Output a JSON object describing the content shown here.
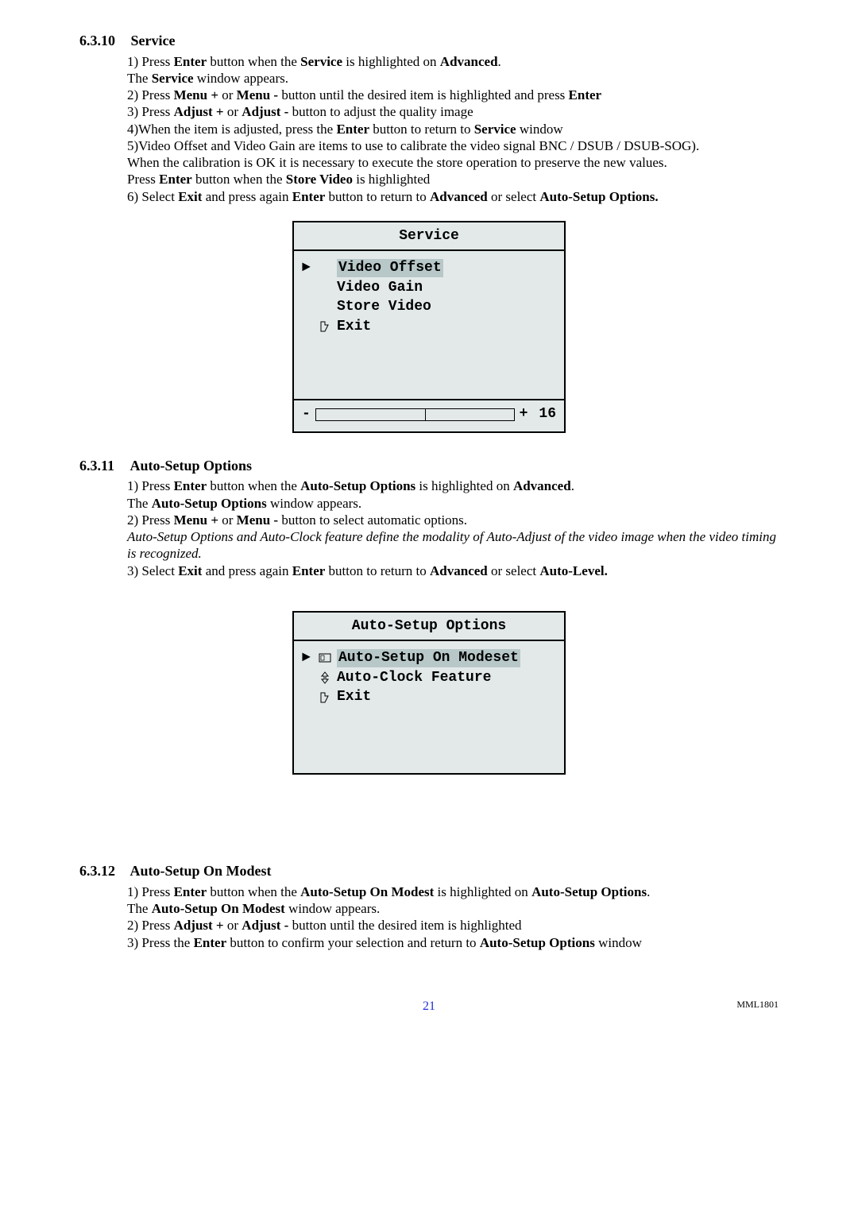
{
  "sections": {
    "service": {
      "num": "6.3.10",
      "title": "Service",
      "lines": {
        "l1a": "1) Press ",
        "l1b": "Enter",
        "l1c": " button when the ",
        "l1d": "Service",
        "l1e": " is highlighted on ",
        "l1f": "Advanced",
        "l1g": ".",
        "l2a": "The ",
        "l2b": "Service",
        "l2c": " window appears.",
        "l3a": "2) Press ",
        "l3b": "Menu +",
        "l3c": " or ",
        "l3d": "Menu -",
        "l3e": " button until the desired item is highlighted and press ",
        "l3f": "Enter",
        "l4a": "3) Press ",
        "l4b": "Adjust +",
        "l4c": " or ",
        "l4d": "Adjust -",
        "l4e": " button to adjust the quality image",
        "l5a": "4)When the item is adjusted, press the ",
        "l5b": "Enter",
        "l5c": " button to return to ",
        "l5d": "Service",
        "l5e": " window",
        "l6": "5)Video Offset and Video Gain  are items to use to calibrate the video signal BNC / DSUB / DSUB-SOG).",
        "l7": "When the calibration is OK it is necessary to execute the store operation to preserve the new values.",
        "l8a": "Press ",
        "l8b": "Enter",
        "l8c": " button when the ",
        "l8d": "Store Video",
        "l8e": " is highlighted",
        "l9a": "6) Select ",
        "l9b": "Exit",
        "l9c": " and press again ",
        "l9d": "Enter",
        "l9e": " button to return to ",
        "l9f": "Advanced",
        "l9g": " or select  ",
        "l9h": "Auto-Setup Options."
      },
      "osd": {
        "title": "Service",
        "item1": "Video Offset",
        "item2": "Video Gain",
        "item3": "Store Video",
        "item4": "Exit",
        "minus": "-",
        "plus": "+",
        "value": "16"
      }
    },
    "auto_options": {
      "num": "6.3.11",
      "title": "Auto-Setup Options",
      "lines": {
        "l1a": "1) Press ",
        "l1b": "Enter",
        "l1c": " button when the ",
        "l1d": "Auto-Setup Options",
        "l1e": " is highlighted on ",
        "l1f": "Advanced",
        "l1g": ".",
        "l2a": "The ",
        "l2b": "Auto-Setup Options",
        "l2c": " window appears.",
        "l3a": "2) Press ",
        "l3b": "Menu +",
        "l3c": " or ",
        "l3d": "Menu -",
        "l3e": " button to select automatic options.",
        "l4": "Auto-Setup Options and Auto-Clock feature define the modality of Auto-Adjust of the video image when the video timing is recognized.",
        "l5a": "3) Select ",
        "l5b": "Exit",
        "l5c": " and press again ",
        "l5d": "Enter",
        "l5e": " button to return to ",
        "l5f": "Advanced",
        "l5g": " or select  ",
        "l5h": "Auto-Level."
      },
      "osd": {
        "title": "Auto-Setup Options",
        "item1": "Auto-Setup On Modeset",
        "item2": "Auto-Clock Feature",
        "item3": "Exit"
      }
    },
    "auto_modest": {
      "num": "6.3.12",
      "title": "Auto-Setup On Modest",
      "lines": {
        "l1a": "1) Press ",
        "l1b": "Enter",
        "l1c": " button when the ",
        "l1d": "Auto-Setup On Modest",
        "l1e": " is highlighted on ",
        "l1f": "Auto-Setup Options",
        "l1g": ".",
        "l2a": "The ",
        "l2b": "Auto-Setup On Modest",
        "l2c": " window appears.",
        "l3a": "2) Press ",
        "l3b": "Adjust +",
        "l3c": " or ",
        "l3d": "Adjust -",
        "l3e": " button until the desired item is highlighted",
        "l4a": "3) Press the ",
        "l4b": "Enter",
        "l4c": " button to confirm your selection and return to ",
        "l4d": "Auto-Setup Options",
        "l4e": " window"
      }
    }
  },
  "footer": {
    "page": "21",
    "model": "MML1801"
  }
}
